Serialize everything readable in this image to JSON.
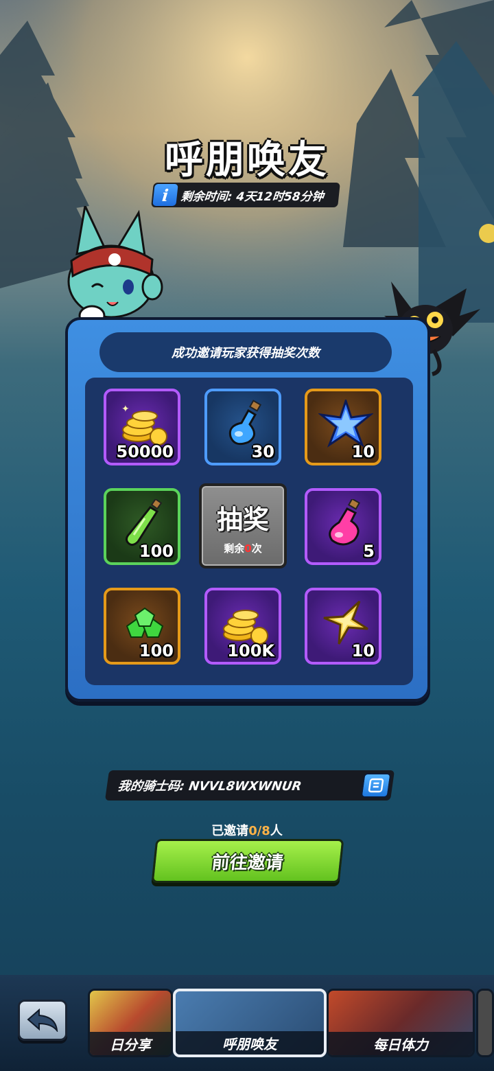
{
  "title": "呼朋唤友",
  "timer": {
    "info_icon": "i",
    "text": "剩余时间: 4天12时58分钟"
  },
  "panel": {
    "header": "成功邀请玩家获得抽奖次数",
    "rewards": [
      {
        "icon": "gold-coins-icon",
        "qty": "50000",
        "frame": "purple"
      },
      {
        "icon": "blue-potion-icon",
        "qty": "30",
        "frame": "blue"
      },
      {
        "icon": "blue-crystal-star-icon",
        "qty": "10",
        "frame": "orange"
      },
      {
        "icon": "green-potion-icon",
        "qty": "100",
        "frame": "green"
      },
      {
        "icon": "pink-potion-icon",
        "qty": "5",
        "frame": "purple"
      },
      {
        "icon": "green-gems-icon",
        "qty": "100",
        "frame": "orange"
      },
      {
        "icon": "gold-coins-icon",
        "qty": "100K",
        "frame": "purple"
      },
      {
        "icon": "gold-star-icon",
        "qty": "10",
        "frame": "purple"
      }
    ],
    "lottery": {
      "label": "抽奖",
      "remain_prefix": "剩余",
      "remain_count": "0",
      "remain_suffix": "次"
    }
  },
  "knight_code": {
    "label": "我的骑士码: NVVL8WXWNUR"
  },
  "invited": {
    "prefix": "已邀请",
    "count": "0/8",
    "suffix": "人"
  },
  "go_button": "前往邀请",
  "bottom_tabs": [
    {
      "label": "日分享",
      "selected": false
    },
    {
      "label": "呼朋唤友",
      "selected": true
    },
    {
      "label": "每日体力",
      "selected": false
    }
  ],
  "colors": {
    "accent_green": "#7ed634",
    "panel_blue": "#3a86dc",
    "highlight_orange": "#ffb347",
    "zero_red": "#ff3333"
  }
}
